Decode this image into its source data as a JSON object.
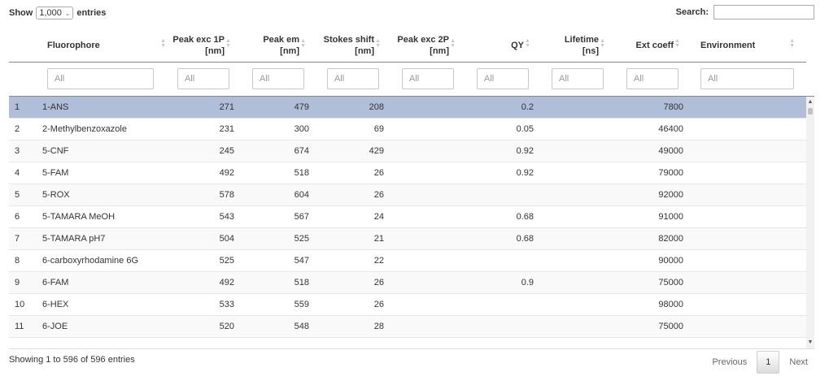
{
  "length_control": {
    "show_label": "Show",
    "value": "1,000",
    "entries_label": "entries"
  },
  "search": {
    "label": "Search:",
    "value": ""
  },
  "columns": [
    {
      "key": "idx",
      "l1": "",
      "l2": ""
    },
    {
      "key": "fluorophore",
      "l1": "Fluorophore",
      "l2": ""
    },
    {
      "key": "peak_exc_1p",
      "l1": "Peak exc 1P",
      "l2": "[nm]"
    },
    {
      "key": "peak_em",
      "l1": "Peak em",
      "l2": "[nm]"
    },
    {
      "key": "stokes",
      "l1": "Stokes shift",
      "l2": "[nm]"
    },
    {
      "key": "peak_exc_2p",
      "l1": "Peak exc 2P",
      "l2": "[nm]"
    },
    {
      "key": "qy",
      "l1": "QY",
      "l2": ""
    },
    {
      "key": "lifetime",
      "l1": "Lifetime",
      "l2": "[ns]"
    },
    {
      "key": "ext_coeff",
      "l1": "Ext coeff",
      "l2": ""
    },
    {
      "key": "environment",
      "l1": "Environment",
      "l2": ""
    }
  ],
  "filter_placeholder": "All",
  "rows": [
    {
      "idx": "1",
      "fluorophore": "1-ANS",
      "peak_exc_1p": "271",
      "peak_em": "479",
      "stokes": "208",
      "peak_exc_2p": "",
      "qy": "0.2",
      "lifetime": "",
      "ext_coeff": "7800",
      "environment": "",
      "selected": true
    },
    {
      "idx": "2",
      "fluorophore": "2-Methylbenzoxazole",
      "peak_exc_1p": "231",
      "peak_em": "300",
      "stokes": "69",
      "peak_exc_2p": "",
      "qy": "0.05",
      "lifetime": "",
      "ext_coeff": "46400",
      "environment": ""
    },
    {
      "idx": "3",
      "fluorophore": "5-CNF",
      "peak_exc_1p": "245",
      "peak_em": "674",
      "stokes": "429",
      "peak_exc_2p": "",
      "qy": "0.92",
      "lifetime": "",
      "ext_coeff": "49000",
      "environment": ""
    },
    {
      "idx": "4",
      "fluorophore": "5-FAM",
      "peak_exc_1p": "492",
      "peak_em": "518",
      "stokes": "26",
      "peak_exc_2p": "",
      "qy": "0.92",
      "lifetime": "",
      "ext_coeff": "79000",
      "environment": ""
    },
    {
      "idx": "5",
      "fluorophore": "5-ROX",
      "peak_exc_1p": "578",
      "peak_em": "604",
      "stokes": "26",
      "peak_exc_2p": "",
      "qy": "",
      "lifetime": "",
      "ext_coeff": "92000",
      "environment": ""
    },
    {
      "idx": "6",
      "fluorophore": "5-TAMARA MeOH",
      "peak_exc_1p": "543",
      "peak_em": "567",
      "stokes": "24",
      "peak_exc_2p": "",
      "qy": "0.68",
      "lifetime": "",
      "ext_coeff": "91000",
      "environment": ""
    },
    {
      "idx": "7",
      "fluorophore": "5-TAMARA pH7",
      "peak_exc_1p": "504",
      "peak_em": "525",
      "stokes": "21",
      "peak_exc_2p": "",
      "qy": "0.68",
      "lifetime": "",
      "ext_coeff": "82000",
      "environment": ""
    },
    {
      "idx": "8",
      "fluorophore": "6-carboxyrhodamine 6G",
      "peak_exc_1p": "525",
      "peak_em": "547",
      "stokes": "22",
      "peak_exc_2p": "",
      "qy": "",
      "lifetime": "",
      "ext_coeff": "90000",
      "environment": ""
    },
    {
      "idx": "9",
      "fluorophore": "6-FAM",
      "peak_exc_1p": "492",
      "peak_em": "518",
      "stokes": "26",
      "peak_exc_2p": "",
      "qy": "0.9",
      "lifetime": "",
      "ext_coeff": "75000",
      "environment": ""
    },
    {
      "idx": "10",
      "fluorophore": "6-HEX",
      "peak_exc_1p": "533",
      "peak_em": "559",
      "stokes": "26",
      "peak_exc_2p": "",
      "qy": "",
      "lifetime": "",
      "ext_coeff": "98000",
      "environment": ""
    },
    {
      "idx": "11",
      "fluorophore": "6-JOE",
      "peak_exc_1p": "520",
      "peak_em": "548",
      "stokes": "28",
      "peak_exc_2p": "",
      "qy": "",
      "lifetime": "",
      "ext_coeff": "75000",
      "environment": ""
    }
  ],
  "info_text": "Showing 1 to 596 of 596 entries",
  "pagination": {
    "previous": "Previous",
    "current": "1",
    "next": "Next"
  },
  "colors": {
    "selected_row": "#b0bed9",
    "stripe": "#f9f9f9",
    "border": "#888888"
  }
}
